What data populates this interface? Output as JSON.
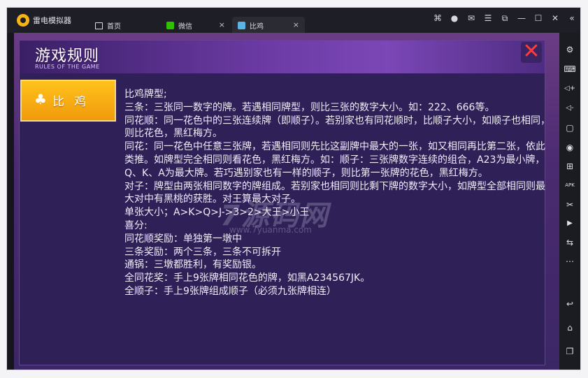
{
  "app": {
    "title": "雷电模拟器"
  },
  "tabs": [
    {
      "label": "首页",
      "icon": "home-icon"
    },
    {
      "label": "微信",
      "icon": "wechat-icon",
      "close": "×"
    },
    {
      "label": "比鸡",
      "icon": "game-icon",
      "close": "×"
    }
  ],
  "window_controls": [
    {
      "name": "gamepad-icon",
      "glyph": "⌘"
    },
    {
      "name": "user-icon",
      "glyph": "●"
    },
    {
      "name": "mail-icon",
      "glyph": "✉"
    },
    {
      "name": "menu-icon",
      "glyph": "☰"
    },
    {
      "name": "restore-icon",
      "glyph": "⧉"
    },
    {
      "name": "minimize-icon",
      "glyph": "—"
    },
    {
      "name": "maximize-icon",
      "glyph": "☐"
    },
    {
      "name": "close-icon",
      "glyph": "✕"
    },
    {
      "name": "collapse-icon",
      "glyph": "«"
    }
  ],
  "sidebar_tools": [
    {
      "name": "settings-icon",
      "glyph": "⚙"
    },
    {
      "name": "keyboard-icon",
      "glyph": "⌨"
    },
    {
      "name": "volume-up-icon",
      "glyph": "◁+"
    },
    {
      "name": "volume-down-icon",
      "glyph": "◁-"
    },
    {
      "name": "screenshot-icon",
      "glyph": "▢"
    },
    {
      "name": "record-icon",
      "glyph": "◉"
    },
    {
      "name": "install-icon",
      "glyph": "⊞"
    },
    {
      "name": "apk-icon",
      "glyph": "APK"
    },
    {
      "name": "scissors-icon",
      "glyph": "✂"
    },
    {
      "name": "video-icon",
      "glyph": "▶"
    },
    {
      "name": "sync-icon",
      "glyph": "⇆"
    },
    {
      "name": "more-icon",
      "glyph": "⋯"
    },
    {
      "name": "back-icon",
      "glyph": "↩"
    },
    {
      "name": "home-nav-icon",
      "glyph": "⌂"
    },
    {
      "name": "recent-icon",
      "glyph": "❐"
    }
  ],
  "rules_panel": {
    "title": "游戏规则",
    "subtitle": "RULES OF THE GAME",
    "close_glyph": "✕",
    "side_tab": {
      "clover": "♣",
      "label": "比鸡"
    },
    "lines": [
      "比鸡牌型;",
      "三条：三张同一数字的牌。若遇相同牌型，则比三张的数字大小。如：222、666等。",
      "同花顺：同一花色中的三张连续牌（即顺子）。若别家也有同花顺时，比顺子大小，如顺子也相同，则比花色，黑红梅方。",
      "同花：同一花色中任意三张牌，若遇相同则先比这副牌中最大的一张，如又相同再比第二张，依此类推。如牌型完全相同则看花色，黑红梅方。如：顺子：三张牌数字连续的组合，A23为最小牌，Q、K、A为最大牌。若巧遇别家也有一样的顺子，则比第一张牌的花色，黑红梅方。",
      "对子：牌型由两张相同数字的牌组成。若别家也相同则比剩下牌的数字大小，如牌型全部相同则最大对中有黑桃的获胜。对王算最大对子。",
      "单张大小；A>K>Q>J->3>2>大王>小王",
      "喜分:",
      "同花顺奖励：单独第一墩中",
      "三条奖励：两个三条，三条不可拆开",
      "通锅：三墩都胜利，有奖励银。",
      "全同花奖：手上9张牌相同花色的牌，如黑A234567JK。",
      "全顺子：手上9张牌组成顺子（必须九张牌相连）"
    ]
  },
  "watermark": {
    "text": "7源码网",
    "sub": "www.7yuanma.com"
  }
}
